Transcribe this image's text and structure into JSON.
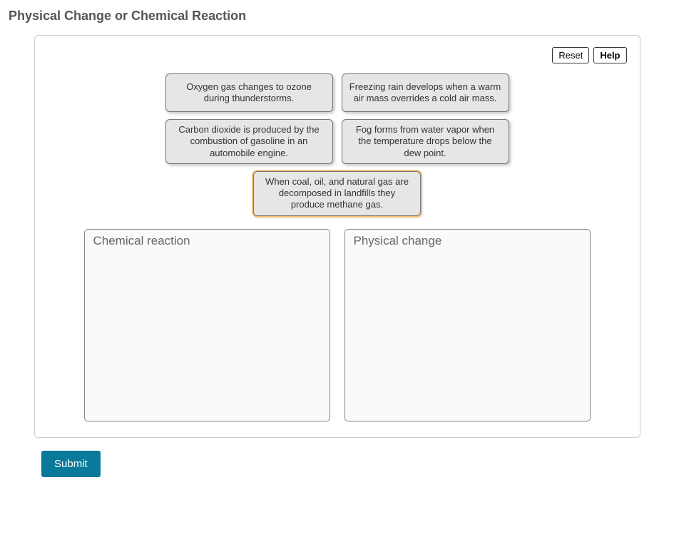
{
  "title": "Physical Change or Chemical Reaction",
  "toolbar": {
    "reset": "Reset",
    "help": "Help"
  },
  "cards": [
    "Oxygen gas changes to ozone during thunderstorms.",
    "Freezing rain develops when a warm air mass overrides a cold air mass.",
    "Carbon dioxide is produced by the combustion of gasoline in an automobile engine.",
    "Fog forms from water vapor when the temperature drops below the dew point.",
    "When coal, oil, and natural gas are decomposed in landfills they produce methane gas."
  ],
  "zones": {
    "left": "Chemical reaction",
    "right": "Physical change"
  },
  "submit": "Submit"
}
